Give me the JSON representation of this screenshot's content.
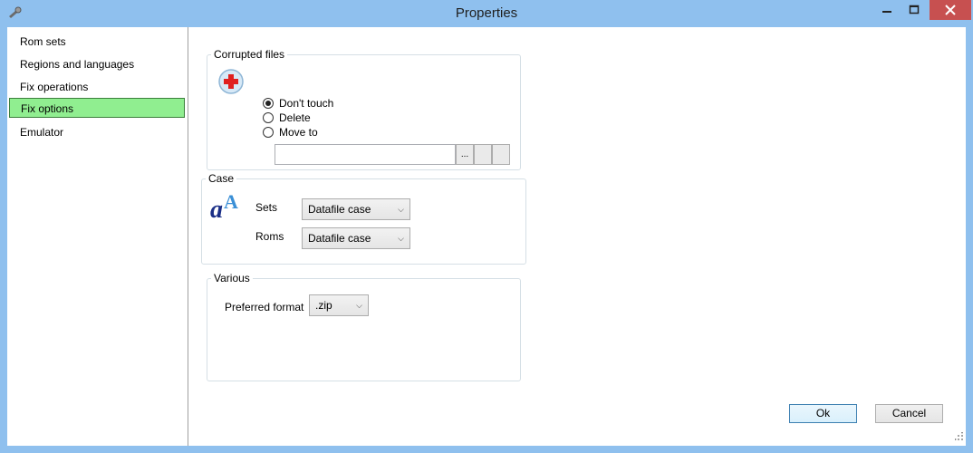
{
  "window": {
    "title": "Properties",
    "accent": "#8fc0ee",
    "close_hover": "#c75050"
  },
  "titlebar_icons": {
    "app": "gear-wrench-icon",
    "minimize": "minimize-icon",
    "maximize": "maximize-icon",
    "close": "close-icon"
  },
  "nav": {
    "items": [
      {
        "label": "Rom sets"
      },
      {
        "label": "Regions and languages"
      },
      {
        "label": "Fix operations"
      },
      {
        "label": "Fix options",
        "selected": true
      },
      {
        "label": "Emulator"
      }
    ],
    "selected_color": "#90ee90"
  },
  "corrupted": {
    "title": "Corrupted files",
    "icon": "medical-cross-icon",
    "options": [
      "Don't touch",
      "Delete",
      "Move to"
    ],
    "selected": "Don't touch",
    "move_to_path": "",
    "browse_label": "..."
  },
  "case": {
    "title": "Case",
    "icon": "case-letters-icon",
    "sets_label": "Sets",
    "sets_value": "Datafile case",
    "roms_label": "Roms",
    "roms_value": "Datafile case"
  },
  "various": {
    "title": "Various",
    "format_label": "Preferred format",
    "format_value": ".zip"
  },
  "buttons": {
    "ok": "Ok",
    "cancel": "Cancel"
  }
}
